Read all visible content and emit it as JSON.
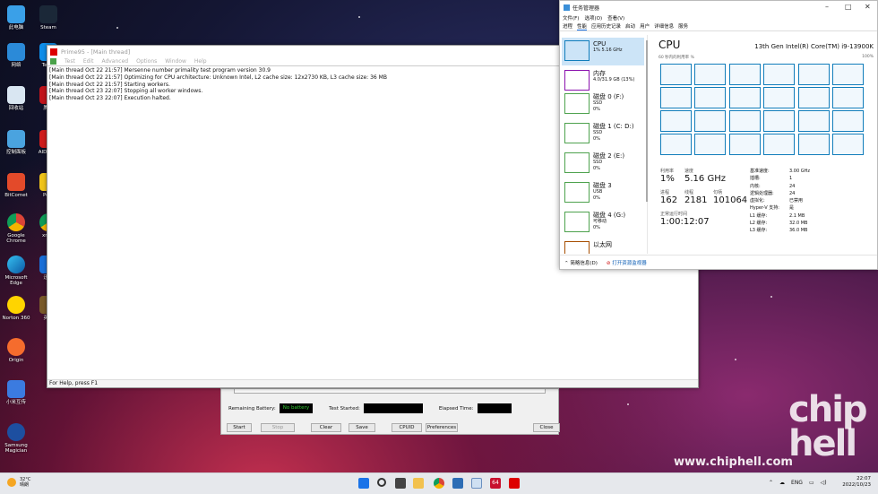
{
  "desktop": {
    "icons": [
      {
        "label": "此电脑",
        "icon": "computer-icon"
      },
      {
        "label": "Steam",
        "icon": "steam-icon"
      },
      {
        "label": "网络",
        "icon": "network-icon"
      },
      {
        "label": "Team",
        "icon": "teamviewer-icon"
      },
      {
        "label": "回收站",
        "icon": "recycle-bin-icon"
      },
      {
        "label": "腾讯",
        "icon": "tencent-icon"
      },
      {
        "label": "控制面板",
        "icon": "control-panel-icon"
      },
      {
        "label": "AID Extr",
        "icon": "aida64-icon"
      },
      {
        "label": "BitComet",
        "icon": "bitcomet-icon"
      },
      {
        "label": "PotP",
        "icon": "potplayer-icon"
      },
      {
        "label": "Google Chrome",
        "icon": "chrome-icon"
      },
      {
        "label": "xmp-",
        "icon": "xmp-icon"
      },
      {
        "label": "Microsoft Edge",
        "icon": "edge-icon"
      },
      {
        "label": "迅雷",
        "icon": "thunder-icon"
      },
      {
        "label": "Norton 360",
        "icon": "norton-icon"
      },
      {
        "label": "英雄",
        "icon": "game-icon"
      },
      {
        "label": "Origin",
        "icon": "origin-icon"
      },
      {
        "label": "小米互传",
        "icon": "mi-share-icon"
      },
      {
        "label": "Samsung Magician",
        "icon": "samsung-magician-icon"
      }
    ]
  },
  "prime95": {
    "title": "Prime95 - [Main thread]",
    "menu": [
      "Test",
      "Edit",
      "Advanced",
      "Options",
      "Window",
      "Help"
    ],
    "log": [
      "[Main thread Oct 22 21:57] Mersenne number primality test program version 30.9",
      "[Main thread Oct 22 21:57] Optimizing for CPU architecture: Unknown Intel, L2 cache size: 12x2730 KB, L3 cache size: 36 MB",
      "[Main thread Oct 22 21:57] Starting workers.",
      "[Main thread Oct 23 22:07] Stopping all worker windows.",
      "[Main thread Oct 23 22:07] Execution halted."
    ],
    "status": "For Help, press F1"
  },
  "dialog": {
    "remaining_battery_label": "Remaining Battery:",
    "remaining_battery_value": "No battery",
    "test_started_label": "Test Started:",
    "elapsed_label": "Elapsed Time:",
    "buttons": [
      "Start",
      "Stop",
      "Clear",
      "Save",
      "CPUID",
      "Preferences",
      "Close"
    ]
  },
  "taskmgr": {
    "title": "任务管理器",
    "menu": [
      "文件(F)",
      "选项(O)",
      "查看(V)"
    ],
    "tabs": [
      "进程",
      "性能",
      "应用历史记录",
      "启动",
      "用户",
      "详细信息",
      "服务"
    ],
    "sidebar": [
      {
        "name": "CPU",
        "sub1": "1% 5.16 GHz",
        "sub2": ""
      },
      {
        "name": "内存",
        "sub1": "4.0/31.9 GB (13%)",
        "sub2": ""
      },
      {
        "name": "磁盘 0 (F:)",
        "sub1": "SSD",
        "sub2": "0%"
      },
      {
        "name": "磁盘 1 (C: D:)",
        "sub1": "SSD",
        "sub2": "0%"
      },
      {
        "name": "磁盘 2 (E:)",
        "sub1": "SSD",
        "sub2": "0%"
      },
      {
        "name": "磁盘 3",
        "sub1": "USB",
        "sub2": "0%"
      },
      {
        "name": "磁盘 4 (G:)",
        "sub1": "可移动",
        "sub2": "0%"
      },
      {
        "name": "以太网",
        "sub1": "",
        "sub2": ""
      }
    ],
    "main": {
      "heading": "CPU",
      "cpu_model": "13th Gen Intel(R) Core(TM) i9-13900K",
      "graph_caption": "60 秒内的利用率 %",
      "graph_max": "100%",
      "usage_label": "利用率",
      "usage": "1%",
      "speed_label": "速度",
      "speed": "5.16 GHz",
      "proc_label": "进程",
      "proc": "162",
      "thread_label": "线程",
      "thread": "2181",
      "handle_label": "句柄",
      "handle": "101064",
      "uptime_label": "正常运行时间",
      "uptime": "1:00:12:07",
      "specs": [
        {
          "k": "基准速度:",
          "v": "3.00 GHz"
        },
        {
          "k": "插槽:",
          "v": "1"
        },
        {
          "k": "内核:",
          "v": "24"
        },
        {
          "k": "逻辑处理器:",
          "v": "24"
        },
        {
          "k": "虚拟化:",
          "v": "已禁用"
        },
        {
          "k": "Hyper-V 支持:",
          "v": "是"
        },
        {
          "k": "L1 缓存:",
          "v": "2.1 MB"
        },
        {
          "k": "L2 缓存:",
          "v": "32.0 MB"
        },
        {
          "k": "L3 缓存:",
          "v": "36.0 MB"
        }
      ]
    },
    "footer": {
      "brief": "简略信息(D)",
      "resmon": "打开资源监视器"
    }
  },
  "weather": {
    "temp": "32°C",
    "cond": "晴朗"
  },
  "tray": {
    "lang": "ENG",
    "time": "22:07",
    "date": "2022/10/23"
  },
  "watermark": "www.chiphell.com",
  "colors": {
    "cpu_graph": "#117dbb",
    "memory": "#8b12ae",
    "disk": "#4ea24e"
  }
}
